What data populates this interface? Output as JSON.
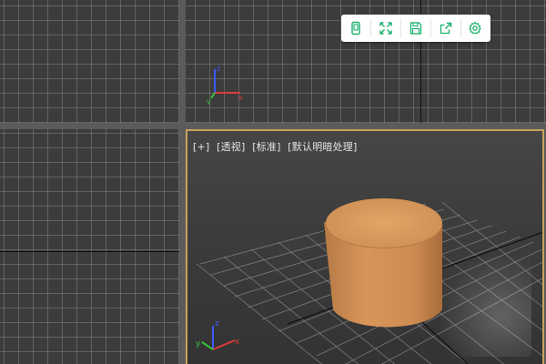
{
  "viewports": {
    "perspective": {
      "labels": [
        "[+]",
        "[透视]",
        "[标准]",
        "[默认明暗处理]"
      ]
    }
  },
  "toolbar": {
    "buttons": [
      {
        "name": "phone-icon"
      },
      {
        "name": "fullscreen-icon"
      },
      {
        "name": "save-icon"
      },
      {
        "name": "share-icon"
      },
      {
        "name": "settings-icon"
      }
    ]
  },
  "colors": {
    "accent": "#c8a25a",
    "toolbar_icon": "#1aaf6c",
    "cylinder": "#d8955a",
    "grid_background": "#3c3c3c"
  },
  "axes": [
    "x",
    "y",
    "z"
  ]
}
